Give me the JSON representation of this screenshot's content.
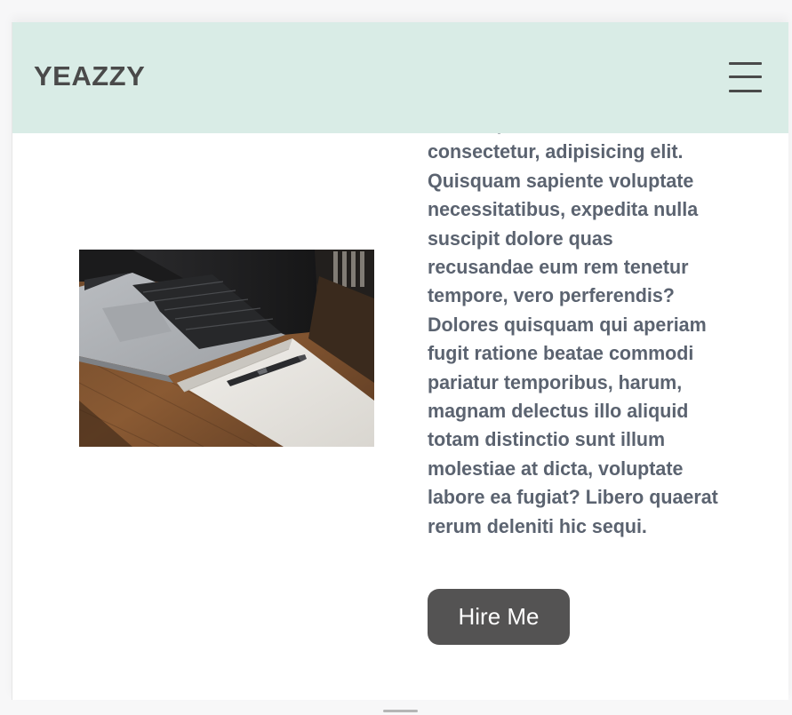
{
  "navbar": {
    "brand": "YEAZZY",
    "menu_icon": "hamburger-menu-icon"
  },
  "hero": {
    "image_alt": "Laptop and notebook with pen on wooden desk",
    "paragraph": "Lorem ipsum dolor sit amet consectetur, adipisicing elit. Quisquam sapiente voluptate necessitatibus, expedita nulla suscipit dolore quas recusandae eum rem tenetur tempore, vero perferendis? Dolores quisquam qui aperiam fugit ratione beatae commodi pariatur temporibus, harum, magnam delectus illo aliquid totam distinctio sunt illum molestiae at dicta, voluptate labore ea fugiat? Libero quaerat rerum deleniti hic sequi.",
    "cta_label": "Hire Me"
  },
  "colors": {
    "navbar_bg": "#d9ece6",
    "brand_text": "#4a4a4a",
    "body_text": "#5b6370",
    "button_bg": "#545353",
    "button_text": "#ffffff"
  }
}
